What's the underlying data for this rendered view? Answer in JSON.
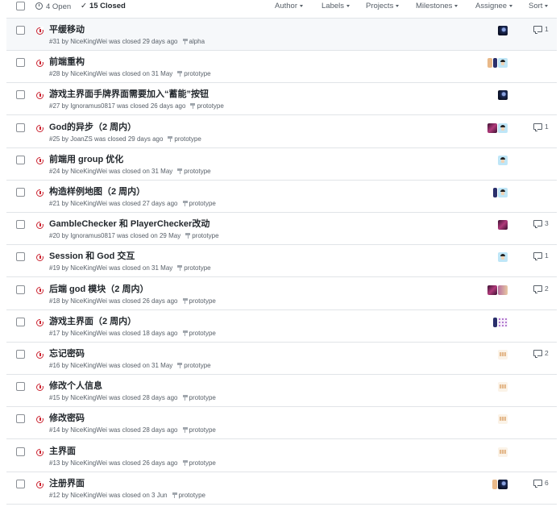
{
  "header": {
    "open_label": "4 Open",
    "closed_label": "15 Closed",
    "closed_check": "✓",
    "filters": [
      "Author",
      "Labels",
      "Projects",
      "Milestones",
      "Assignee",
      "Sort"
    ]
  },
  "issues": [
    {
      "title": "平缓移动",
      "meta": "#31 by NiceKingWei was closed 29 days ago",
      "milestone": "alpha",
      "avatars": [
        "dark"
      ],
      "comments": "1"
    },
    {
      "title": "前端重构",
      "meta": "#28 by NiceKingWei was closed on 31 May",
      "milestone": "prototype",
      "avatars": [
        "small-tan",
        "small-dark",
        "face"
      ],
      "comments": ""
    },
    {
      "title": "游戏主界面手牌界面需要加入“蓄能”按钮",
      "meta": "#27 by Ignoramus0817 was closed 26 days ago",
      "milestone": "prototype",
      "avatars": [
        "dark"
      ],
      "comments": ""
    },
    {
      "title": "God的异步（2 周内）",
      "meta": "#25 by JoanZS was closed 29 days ago",
      "milestone": "prototype",
      "avatars": [
        "magenta",
        "face"
      ],
      "comments": "1"
    },
    {
      "title": "前端用 group 优化",
      "meta": "#24 by NiceKingWei was closed on 31 May",
      "milestone": "prototype",
      "avatars": [
        "face"
      ],
      "comments": ""
    },
    {
      "title": "构造样例地图（2 周内）",
      "meta": "#21 by NiceKingWei was closed 27 days ago",
      "milestone": "prototype",
      "avatars": [
        "small-dark",
        "face"
      ],
      "comments": ""
    },
    {
      "title": "GambleChecker 和 PlayerChecker改动",
      "meta": "#20 by Ignoramus0817 was closed on 29 May",
      "milestone": "prototype",
      "avatars": [
        "magenta"
      ],
      "comments": "3"
    },
    {
      "title": "Session 和 God 交互",
      "meta": "#19 by NiceKingWei was closed on 31 May",
      "milestone": "prototype",
      "avatars": [
        "face"
      ],
      "comments": "1"
    },
    {
      "title": "后端 god 模块（2 周内）",
      "meta": "#18 by NiceKingWei was closed 26 days ago",
      "milestone": "prototype",
      "avatars": [
        "magenta",
        "mix"
      ],
      "comments": "2"
    },
    {
      "title": "游戏主界面（2 周内）",
      "meta": "#17 by NiceKingWei was closed 18 days ago",
      "milestone": "prototype",
      "avatars": [
        "small-dark",
        "dots"
      ],
      "comments": ""
    },
    {
      "title": "忘记密码",
      "meta": "#16 by NiceKingWei was closed on 31 May",
      "milestone": "prototype",
      "avatars": [
        "tan"
      ],
      "comments": "2"
    },
    {
      "title": "修改个人信息",
      "meta": "#15 by NiceKingWei was closed 28 days ago",
      "milestone": "prototype",
      "avatars": [
        "tan"
      ],
      "comments": ""
    },
    {
      "title": "修改密码",
      "meta": "#14 by NiceKingWei was closed 28 days ago",
      "milestone": "prototype",
      "avatars": [
        "tan"
      ],
      "comments": ""
    },
    {
      "title": "主界面",
      "meta": "#13 by NiceKingWei was closed 26 days ago",
      "milestone": "prototype",
      "avatars": [
        "tan"
      ],
      "comments": ""
    },
    {
      "title": "注册界面",
      "meta": "#12 by NiceKingWei was closed on 3 Jun",
      "milestone": "prototype",
      "avatars": [
        "small-tan",
        "dark"
      ],
      "comments": "6"
    }
  ],
  "colors": {
    "closed_icon": "#cb2431",
    "border": "#e1e4e8",
    "muted": "#586069"
  }
}
